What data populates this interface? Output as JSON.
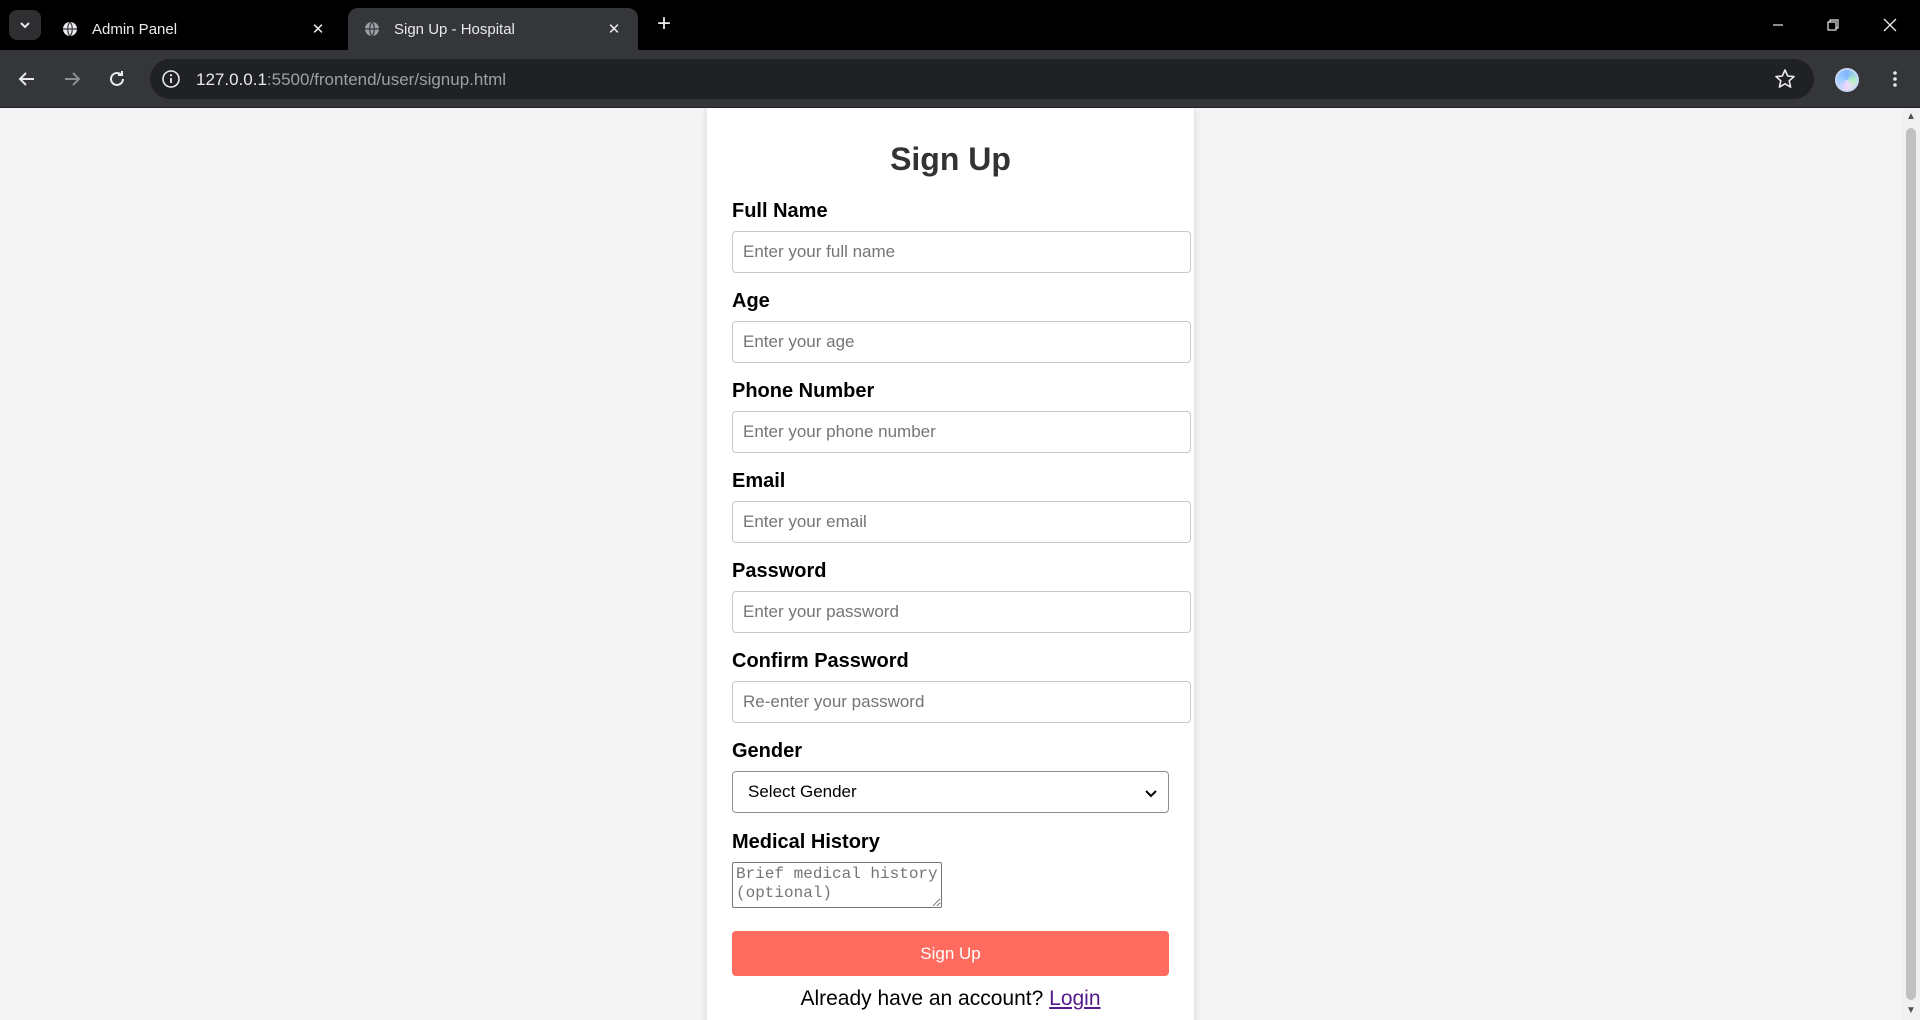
{
  "browser": {
    "tabs": [
      {
        "title": "Admin Panel",
        "active": false
      },
      {
        "title": "Sign Up - Hospital",
        "active": true
      }
    ],
    "url_host": "127.0.0.1",
    "url_rest": ":5500/frontend/user/signup.html"
  },
  "form": {
    "title": "Sign Up",
    "fields": {
      "full_name": {
        "label": "Full Name",
        "placeholder": "Enter your full name",
        "value": ""
      },
      "age": {
        "label": "Age",
        "placeholder": "Enter your age",
        "value": ""
      },
      "phone": {
        "label": "Phone Number",
        "placeholder": "Enter your phone number",
        "value": ""
      },
      "email": {
        "label": "Email",
        "placeholder": "Enter your email",
        "value": ""
      },
      "password": {
        "label": "Password",
        "placeholder": "Enter your password",
        "value": ""
      },
      "confirm_password": {
        "label": "Confirm Password",
        "placeholder": "Re-enter your password",
        "value": ""
      },
      "gender": {
        "label": "Gender",
        "selected": "Select Gender"
      },
      "medical_history": {
        "label": "Medical History",
        "placeholder": "Brief medical history (optional)"
      }
    },
    "submit_label": "Sign Up",
    "footer_text": "Already have an account?",
    "login_link": "Login"
  },
  "colors": {
    "accent": "#ff6b5e",
    "link": "#551a8b",
    "title": "#333333"
  }
}
